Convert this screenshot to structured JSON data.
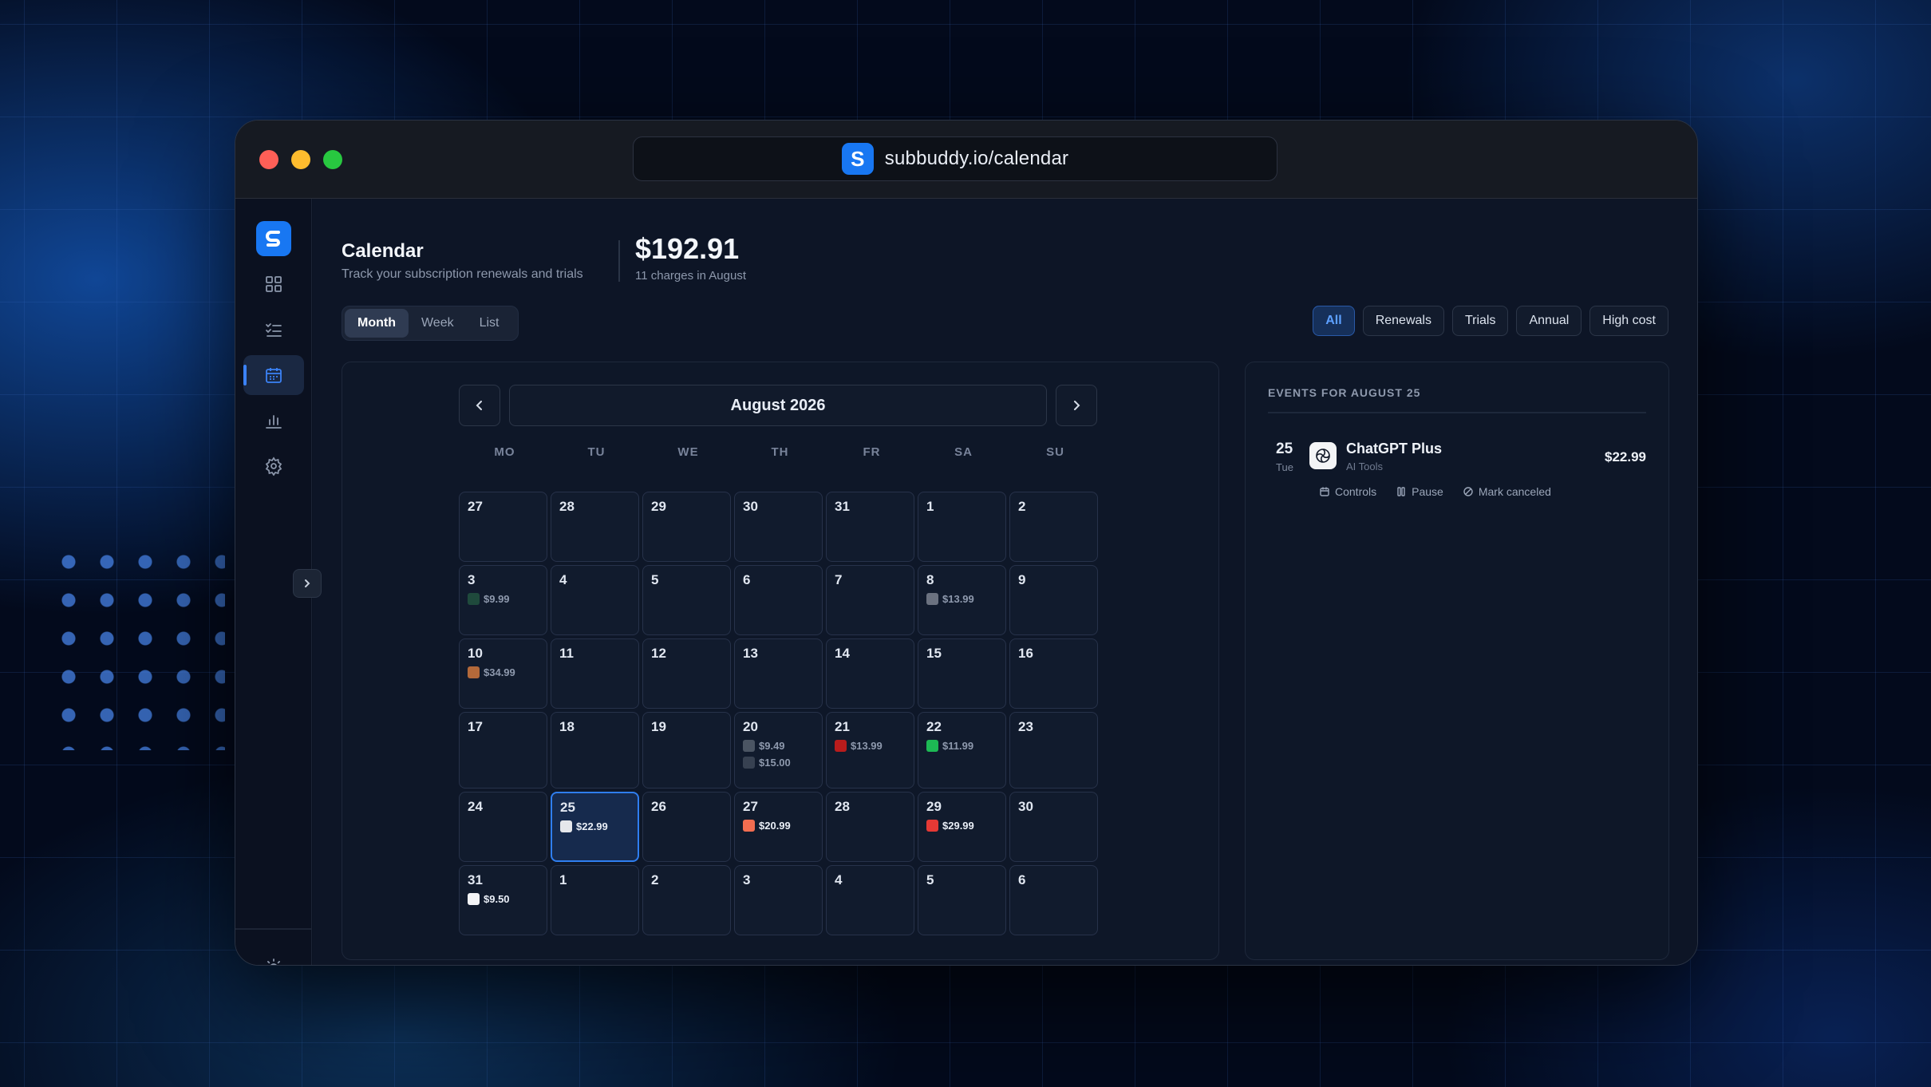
{
  "browser": {
    "url": "subbuddy.io/calendar",
    "logo_letter": "S"
  },
  "sidebar": {
    "items": [
      {
        "icon": "dashboard-grid-icon",
        "active": false
      },
      {
        "icon": "checklist-icon",
        "active": false
      },
      {
        "icon": "calendar-icon",
        "active": true
      },
      {
        "icon": "bar-chart-icon",
        "active": false
      },
      {
        "icon": "gear-icon",
        "active": false
      }
    ],
    "bottom": [
      {
        "icon": "sun-icon"
      },
      {
        "icon": "logout-icon"
      }
    ]
  },
  "header": {
    "title": "Calendar",
    "subtitle": "Track your subscription renewals and trials",
    "total": "$192.91",
    "charges": "11 charges in August"
  },
  "view_tabs": [
    {
      "label": "Month",
      "active": true
    },
    {
      "label": "Week",
      "active": false
    },
    {
      "label": "List",
      "active": false
    }
  ],
  "filters": [
    {
      "label": "All",
      "active": true
    },
    {
      "label": "Renewals",
      "active": false
    },
    {
      "label": "Trials",
      "active": false
    },
    {
      "label": "Annual",
      "active": false
    },
    {
      "label": "High cost",
      "active": false
    }
  ],
  "calendar": {
    "month_label": "August 2026",
    "weekdays": [
      "MO",
      "TU",
      "WE",
      "TH",
      "FR",
      "SA",
      "SU"
    ],
    "weeks": [
      [
        {
          "day": "27",
          "events": []
        },
        {
          "day": "28",
          "events": []
        },
        {
          "day": "29",
          "events": []
        },
        {
          "day": "30",
          "events": []
        },
        {
          "day": "31",
          "events": []
        },
        {
          "day": "1",
          "events": []
        },
        {
          "day": "2",
          "events": []
        }
      ],
      [
        {
          "day": "3",
          "events": [
            {
              "amount": "$9.99",
              "color": "#1f4a3c",
              "icon": "app-icon"
            }
          ]
        },
        {
          "day": "4",
          "events": []
        },
        {
          "day": "5",
          "events": []
        },
        {
          "day": "6",
          "events": []
        },
        {
          "day": "7",
          "events": []
        },
        {
          "day": "8",
          "events": [
            {
              "amount": "$13.99",
              "color": "#6b7280",
              "icon": "app-icon"
            }
          ]
        },
        {
          "day": "9",
          "events": []
        }
      ],
      [
        {
          "day": "10",
          "events": [
            {
              "amount": "$34.99",
              "color": "#b3693a",
              "icon": "app-icon"
            }
          ]
        },
        {
          "day": "11",
          "events": []
        },
        {
          "day": "12",
          "events": []
        },
        {
          "day": "13",
          "events": []
        },
        {
          "day": "14",
          "events": []
        },
        {
          "day": "15",
          "events": []
        },
        {
          "day": "16",
          "events": []
        }
      ],
      [
        {
          "day": "17",
          "events": []
        },
        {
          "day": "18",
          "events": []
        },
        {
          "day": "19",
          "events": []
        },
        {
          "day": "20",
          "events": [
            {
              "amount": "$9.49",
              "color": "#4b5563",
              "icon": "github-icon"
            },
            {
              "amount": "$15.00",
              "color": "#374151",
              "icon": "figma-icon"
            }
          ]
        },
        {
          "day": "21",
          "events": [
            {
              "amount": "$13.99",
              "color": "#b91c1c",
              "icon": "netflix-icon"
            }
          ]
        },
        {
          "day": "22",
          "events": [
            {
              "amount": "$11.99",
              "color": "#1db954",
              "icon": "spotify-icon"
            }
          ]
        },
        {
          "day": "23",
          "events": []
        }
      ],
      [
        {
          "day": "24",
          "events": []
        },
        {
          "day": "25",
          "selected": true,
          "events": [
            {
              "amount": "$22.99",
              "color": "#e5e7eb",
              "icon": "chatgpt-icon"
            }
          ]
        },
        {
          "day": "26",
          "events": []
        },
        {
          "day": "27",
          "events": [
            {
              "amount": "$20.99",
              "color": "#f26d50",
              "icon": "app-icon"
            }
          ]
        },
        {
          "day": "28",
          "events": []
        },
        {
          "day": "29",
          "events": [
            {
              "amount": "$29.99",
              "color": "#e53935",
              "icon": "adobe-icon"
            }
          ]
        },
        {
          "day": "30",
          "events": []
        }
      ],
      [
        {
          "day": "31",
          "events": [
            {
              "amount": "$9.50",
              "color": "#f3f4f6",
              "icon": "notion-icon"
            }
          ]
        },
        {
          "day": "1",
          "events": []
        },
        {
          "day": "2",
          "events": []
        },
        {
          "day": "3",
          "events": []
        },
        {
          "day": "4",
          "events": []
        },
        {
          "day": "5",
          "events": []
        },
        {
          "day": "6",
          "events": []
        }
      ]
    ]
  },
  "events_panel": {
    "heading": "EVENTS FOR AUGUST 25",
    "event": {
      "day": "25",
      "weekday": "Tue",
      "name": "ChatGPT Plus",
      "category": "AI Tools",
      "price": "$22.99",
      "icon": "chatgpt-icon",
      "actions": [
        {
          "label": "Controls",
          "icon": "controls-icon"
        },
        {
          "label": "Pause",
          "icon": "pause-icon"
        },
        {
          "label": "Mark canceled",
          "icon": "cancel-icon"
        }
      ]
    }
  }
}
